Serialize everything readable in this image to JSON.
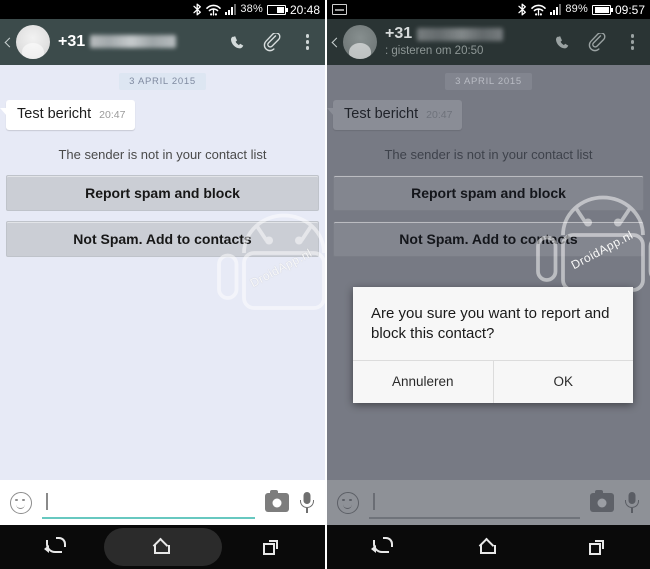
{
  "panels": [
    {
      "id": "left",
      "status_bar": {
        "icons": [
          "bluetooth-icon",
          "wifi-icon",
          "signal-icon"
        ],
        "battery_percent": "38%",
        "clock": "20:48",
        "screenshot_icon": false
      },
      "app_bar": {
        "back_icon": "back-chevron-icon",
        "avatar": "contact-avatar",
        "country_code": "+31",
        "number_blurred": true,
        "subtitle": "",
        "actions": [
          "call-icon",
          "attach-icon",
          "overflow-icon"
        ]
      },
      "chat": {
        "date_separator": "3 APRIL 2015",
        "message": {
          "text": "Test bericht",
          "time": "20:47"
        },
        "notice": "The sender is not in your contact list",
        "buttons": [
          "Report spam and block",
          "Not Spam. Add to contacts"
        ],
        "watermark": "DroidApp.nl"
      },
      "input_bar": {
        "emoji_icon": "emoji-icon",
        "placeholder": "",
        "value": "",
        "camera_icon": "camera-icon",
        "mic_icon": "mic-icon"
      },
      "nav_bar": {
        "back": "nav-back-icon",
        "home": "nav-home-icon",
        "recents": "nav-recents-icon",
        "home_highlighted": true
      },
      "dialog": null
    },
    {
      "id": "right",
      "status_bar": {
        "icons": [
          "screenshot-icon",
          "bluetooth-icon",
          "wifi-icon",
          "signal-icon"
        ],
        "battery_percent": "89%",
        "clock": "09:57",
        "screenshot_icon": true
      },
      "app_bar": {
        "back_icon": "back-chevron-icon",
        "avatar": "contact-avatar",
        "country_code": "+31",
        "number_blurred": true,
        "subtitle": ": gisteren om 20:50",
        "actions": [
          "call-icon",
          "attach-icon",
          "overflow-icon"
        ]
      },
      "chat": {
        "date_separator": "3 APRIL 2015",
        "message": {
          "text": "Test bericht",
          "time": "20:47"
        },
        "notice": "The sender is not in your contact list",
        "buttons": [
          "Report spam and block",
          "Not Spam. Add to contacts"
        ],
        "watermark": "DroidApp.nl"
      },
      "input_bar": {
        "emoji_icon": "emoji-icon",
        "placeholder": "",
        "value": "",
        "camera_icon": "camera-icon",
        "mic_icon": "mic-icon"
      },
      "nav_bar": {
        "back": "nav-back-icon",
        "home": "nav-home-icon",
        "recents": "nav-recents-icon",
        "home_highlighted": false
      },
      "dialog": {
        "message": "Are you sure you want to report and block this contact?",
        "cancel_label": "Annuleren",
        "confirm_label": "OK"
      }
    }
  ],
  "colors": {
    "app_bar": "#3c4b4b",
    "app_bar_dim": "#2a3434",
    "chat_bg": "#e7eaf6",
    "chat_bg_dim": "#777a84",
    "accent_underline": "#67c8c0",
    "spam_button": "#cbced5",
    "nav_bar": "#0a0a0a",
    "status_bar": "#000000",
    "dialog_bg": "#f7f7f7"
  }
}
